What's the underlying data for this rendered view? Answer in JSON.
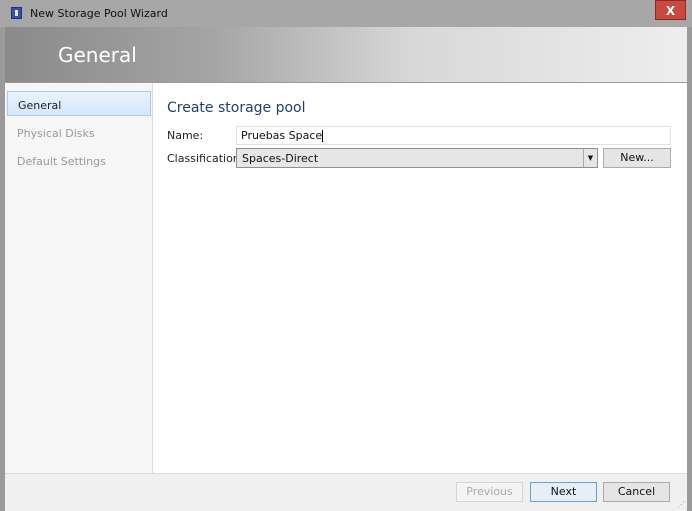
{
  "window": {
    "title": "New Storage Pool Wizard",
    "close_label": "X"
  },
  "header": {
    "title": "General"
  },
  "sidebar": {
    "items": [
      {
        "label": "General",
        "active": true
      },
      {
        "label": "Physical Disks"
      },
      {
        "label": "Default Settings"
      }
    ]
  },
  "main": {
    "heading": "Create storage pool",
    "name_label": "Name:",
    "name_value": "Pruebas Space",
    "classification_label": "Classification:",
    "classification_value": "Spaces-Direct",
    "new_button": "New..."
  },
  "footer": {
    "previous": "Previous",
    "next": "Next",
    "cancel": "Cancel"
  }
}
